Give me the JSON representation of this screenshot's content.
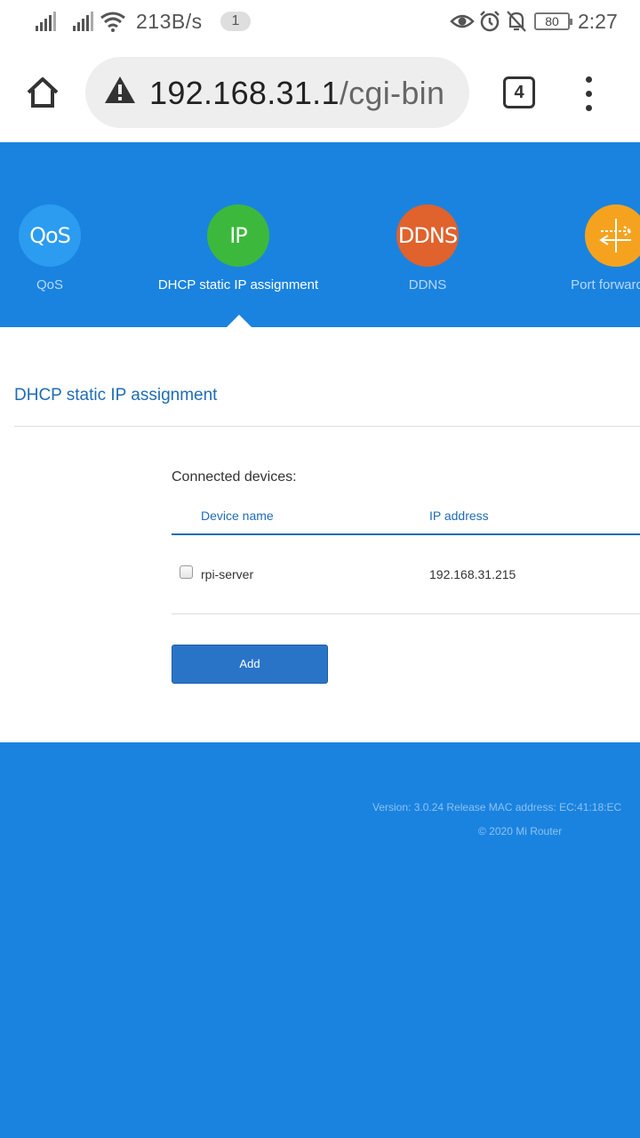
{
  "status_bar": {
    "net_speed": "213B/s",
    "notification_count": "1",
    "battery_level": "80",
    "time": "2:27"
  },
  "browser": {
    "url_host": "192.168.31.1",
    "url_path": "/cgi-bin",
    "tab_count": "4"
  },
  "nav": {
    "items": [
      {
        "icon_text": "QoS",
        "label": "QoS",
        "color": "#2b9cf0"
      },
      {
        "icon_text": "IP",
        "label": "DHCP static IP assignment",
        "color": "#3cb93c",
        "active": true
      },
      {
        "icon_text": "DDNS",
        "label": "DDNS",
        "color": "#e0622c"
      },
      {
        "icon_text": "",
        "label": "Port forwarding",
        "color": "#f5a31e"
      }
    ]
  },
  "page": {
    "title": "DHCP static IP assignment",
    "connected_label": "Connected devices:",
    "columns": {
      "device_name": "Device name",
      "ip_address": "IP address"
    },
    "rows": [
      {
        "device_name": "rpi-server",
        "ip_address": "192.168.31.215",
        "checked": false
      }
    ],
    "add_label": "Add"
  },
  "footer": {
    "version": "Version: 3.0.24 Release  MAC address: EC:41:18:EC",
    "copyright": "© 2020 Mi Router"
  },
  "colors": {
    "brand_blue": "#1a83e0",
    "link_blue": "#1e6cb5"
  }
}
